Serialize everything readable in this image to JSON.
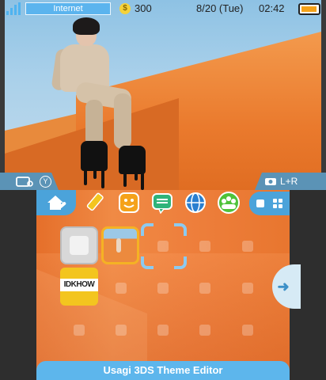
{
  "status_bar": {
    "wifi_label": "Internet",
    "coin_count": "300",
    "date": "8/20 (Tue)",
    "time": "02:42"
  },
  "top_screen": {
    "camera_tab_label": "Y",
    "screenshot_tab_label": "L+R"
  },
  "bottom_screen": {
    "toolbar_items": [
      "home-settings",
      "notes",
      "friend-list",
      "notifications",
      "internet-browser",
      "miiverse"
    ],
    "apps": [
      {
        "name": "settings-slot"
      },
      {
        "name": "photo-app"
      },
      {
        "name": "empty-selected"
      },
      {
        "name": "game-app",
        "label": "IDKHOW"
      }
    ],
    "theme_title": "Usagi 3DS Theme Editor"
  },
  "colors": {
    "accent": "#4ba3da",
    "wallpaper": "#ee7f3c",
    "selection": "#f5b224"
  }
}
